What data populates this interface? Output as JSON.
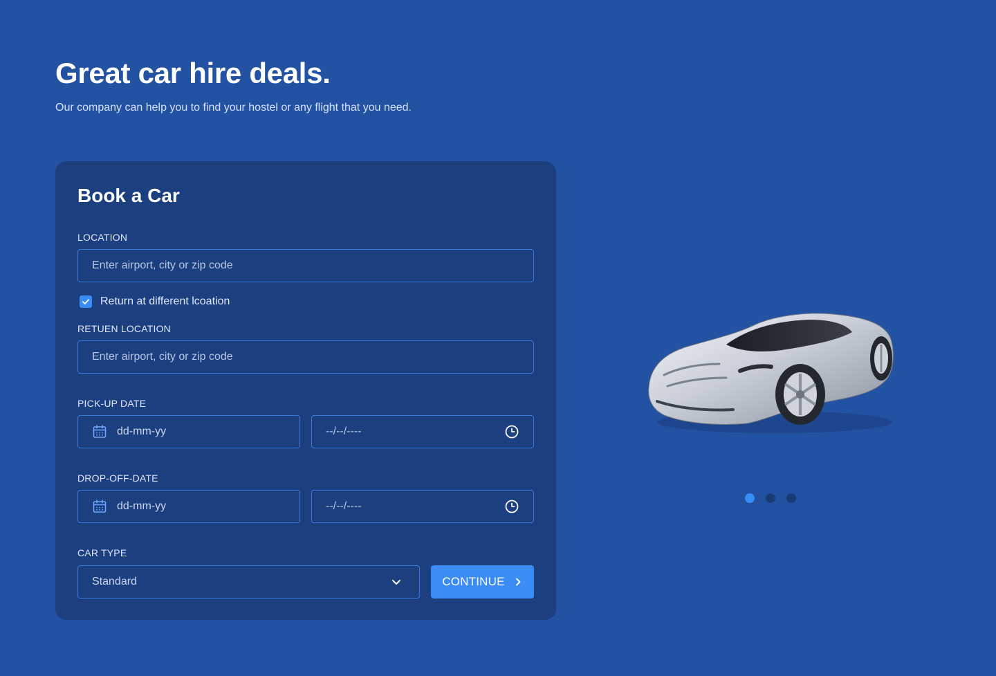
{
  "hero": {
    "title": "Great car hire deals.",
    "subtitle": "Our company can help you to find your hostel or any flight that you need."
  },
  "form": {
    "title": "Book a Car",
    "location": {
      "label": "LOCATION",
      "placeholder": "Enter airport, city or zip code"
    },
    "return_checkbox": {
      "label": "Return at different lcoation",
      "checked": true
    },
    "return_location": {
      "label": "RETUEN LOCATION",
      "placeholder": "Enter airport, city or zip code"
    },
    "pickup": {
      "label": "PICK-UP DATE",
      "date_placeholder": "dd-mm-yy",
      "time_placeholder": "--/--/----"
    },
    "dropoff": {
      "label": "DROP-OFF-DATE",
      "date_placeholder": "dd-mm-yy",
      "time_placeholder": "--/--/----"
    },
    "car_type": {
      "label": "CAR TYPE",
      "selected": "Standard"
    },
    "continue_label": "CONTINUE"
  },
  "carousel": {
    "slide_count": 3,
    "active_index": 0
  },
  "colors": {
    "background": "#2352a3",
    "card": "#1c3f80",
    "accent": "#3b8cf5",
    "input_border": "#3f78d8"
  },
  "icons": [
    "check-icon",
    "calendar-icon",
    "clock-icon",
    "chevron-down-icon",
    "chevron-right-icon"
  ]
}
